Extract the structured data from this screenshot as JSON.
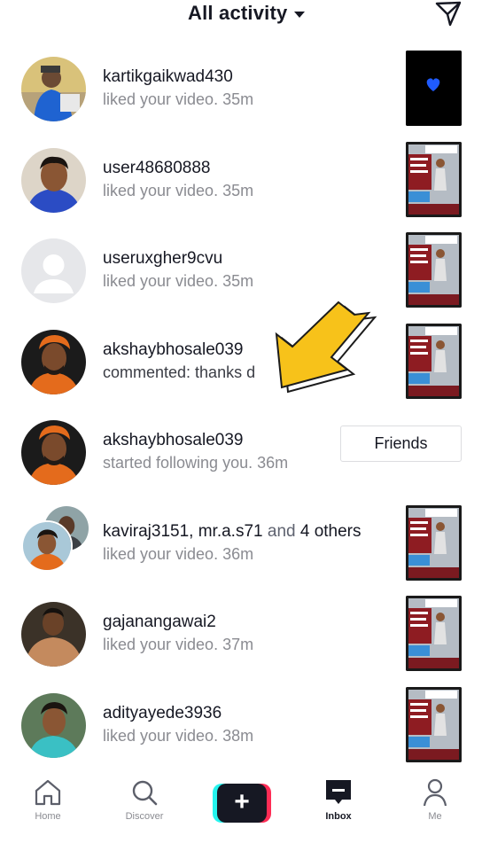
{
  "header": {
    "title": "All activity",
    "dropdown_icon": "caret-down-icon",
    "send_icon": "paper-plane-icon"
  },
  "notifications": [
    {
      "username": "kartikgaikwad430",
      "action": "liked your video.",
      "time": "35m"
    },
    {
      "username": "user48680888",
      "action": "liked your video.",
      "time": "35m"
    },
    {
      "username": "useruxgher9cvu",
      "action": "liked your video.",
      "time": "35m"
    },
    {
      "username": "akshaybhosale039",
      "action": "commented: thanks d"
    },
    {
      "username": "akshaybhosale039",
      "action": "started following you.",
      "time": "36m",
      "button": "Friends"
    },
    {
      "users_first": "kaviraj3151, mr.a.s71",
      "users_and": "and",
      "users_rest": "4 others",
      "action": "liked your video.",
      "time": "36m"
    },
    {
      "username": "gajanangawai2",
      "action": "liked your video.",
      "time": "37m"
    },
    {
      "username": "adityayede3936",
      "action": "liked your video.",
      "time": "38m"
    }
  ],
  "bottom_nav": {
    "home": "Home",
    "discover": "Discover",
    "inbox": "Inbox",
    "me": "Me"
  },
  "colors": {
    "accent_cyan": "#25f4ee",
    "accent_red": "#fe2c55",
    "text_primary": "#161823",
    "text_secondary": "#8a8b91",
    "arrow_yellow": "#f7c21a"
  }
}
